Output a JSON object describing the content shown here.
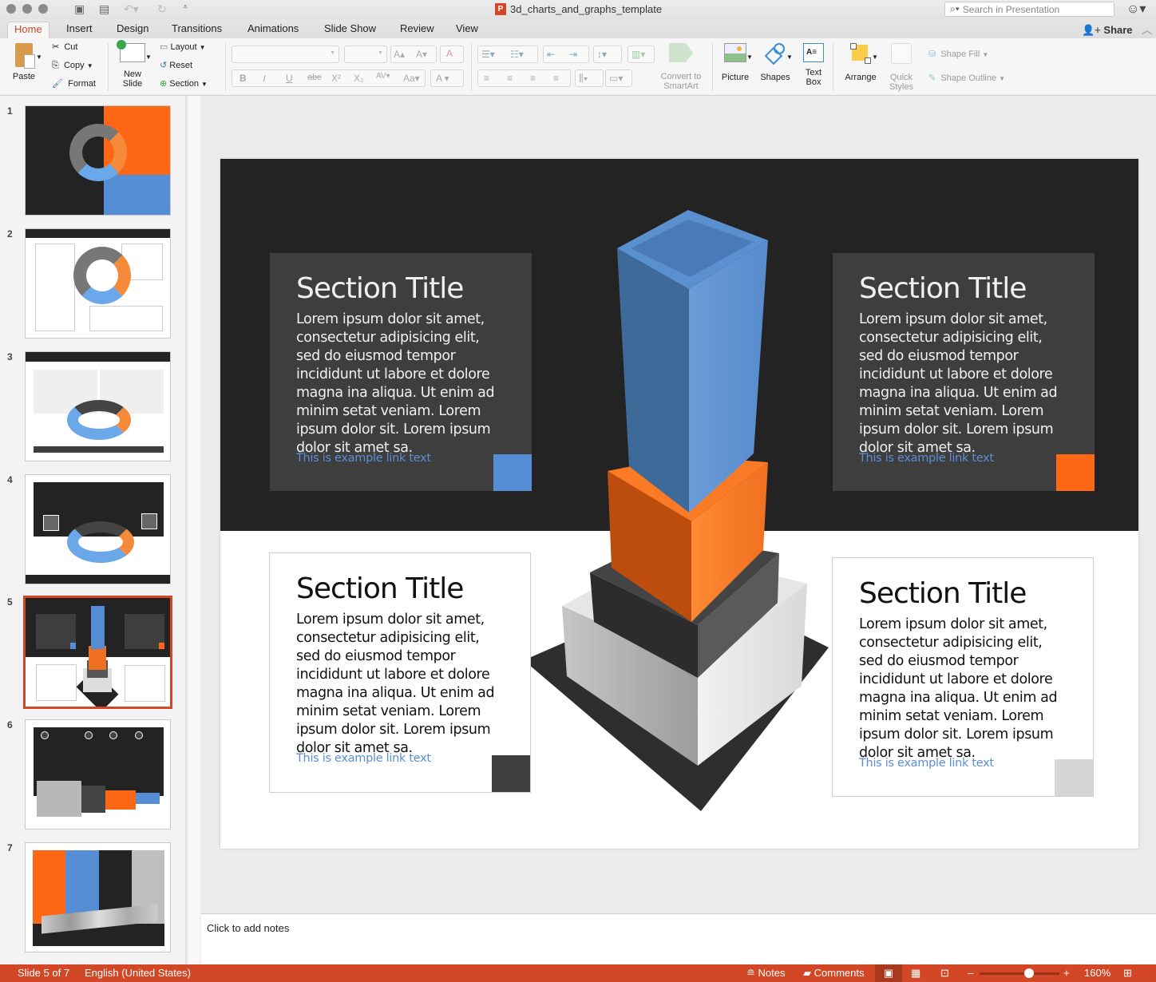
{
  "window": {
    "title": "3d_charts_and_graphs_template",
    "search_placeholder": "Search in Presentation",
    "share_label": "Share"
  },
  "tabs": [
    "Home",
    "Insert",
    "Design",
    "Transitions",
    "Animations",
    "Slide Show",
    "Review",
    "View"
  ],
  "active_tab": "Home",
  "ribbon": {
    "paste": "Paste",
    "cut": "Cut",
    "copy": "Copy",
    "format": "Format",
    "new_slide_1": "New",
    "new_slide_2": "Slide",
    "layout": "Layout",
    "reset": "Reset",
    "section": "Section",
    "bold": "B",
    "italic": "I",
    "underline": "U",
    "strikethrough": "abc",
    "superscript": "X²",
    "subscript": "X₂",
    "convert_1": "Convert to",
    "convert_2": "SmartArt",
    "picture": "Picture",
    "shapes": "Shapes",
    "textbox_1": "Text",
    "textbox_2": "Box",
    "arrange": "Arrange",
    "quick_styles_1": "Quick",
    "quick_styles_2": "Styles",
    "shape_fill": "Shape Fill",
    "shape_outline": "Shape Outline"
  },
  "thumbnails": [
    {
      "num": "1"
    },
    {
      "num": "2"
    },
    {
      "num": "3"
    },
    {
      "num": "4"
    },
    {
      "num": "5",
      "selected": true
    },
    {
      "num": "6"
    },
    {
      "num": "7"
    }
  ],
  "slide": {
    "cards": [
      {
        "title": "Section Title",
        "body": "Lorem ipsum dolor sit amet, consectetur adipisicing elit, sed do eiusmod tempor incididunt ut labore et dolore magna ina aliqua. Ut enim ad minim setat veniam. Lorem ipsum dolor sit. Lorem ipsum dolor sit amet sa.",
        "link": "This is example link text",
        "accent": "#558ed5"
      },
      {
        "title": "Section Title",
        "body": "Lorem ipsum dolor sit amet, consectetur adipisicing elit, sed do eiusmod tempor incididunt ut labore et dolore magna ina aliqua. Ut enim ad minim setat veniam. Lorem ipsum dolor sit. Lorem ipsum dolor sit amet sa.",
        "link": "This is example link text",
        "accent": "#fd6716"
      },
      {
        "title": "Section Title",
        "body": "Lorem ipsum dolor sit amet, consectetur adipisicing elit, sed do eiusmod tempor incididunt ut labore et dolore magna ina aliqua. Ut enim ad minim setat veniam. Lorem ipsum dolor sit. Lorem ipsum dolor sit amet sa.",
        "link": "This is example link text",
        "accent": "#3e3e3e"
      },
      {
        "title": "Section Title",
        "body": "Lorem ipsum dolor sit amet, consectetur adipisicing elit, sed do eiusmod tempor incididunt ut labore et dolore magna ina aliqua. Ut enim ad minim setat veniam. Lorem ipsum dolor sit. Lorem ipsum dolor sit amet sa.",
        "link": "This is example link text",
        "accent": "#d6d6d6"
      }
    ]
  },
  "notes_placeholder": "Click to add notes",
  "status": {
    "slide_info": "Slide 5 of 7",
    "language": "English (United States)",
    "notes": "Notes",
    "comments": "Comments",
    "zoom": "160%",
    "zoom_fraction": 0.62
  },
  "colors": {
    "brand": "#d24726",
    "blue": "#558ed5",
    "orange": "#fd6716",
    "dark": "#232323"
  }
}
